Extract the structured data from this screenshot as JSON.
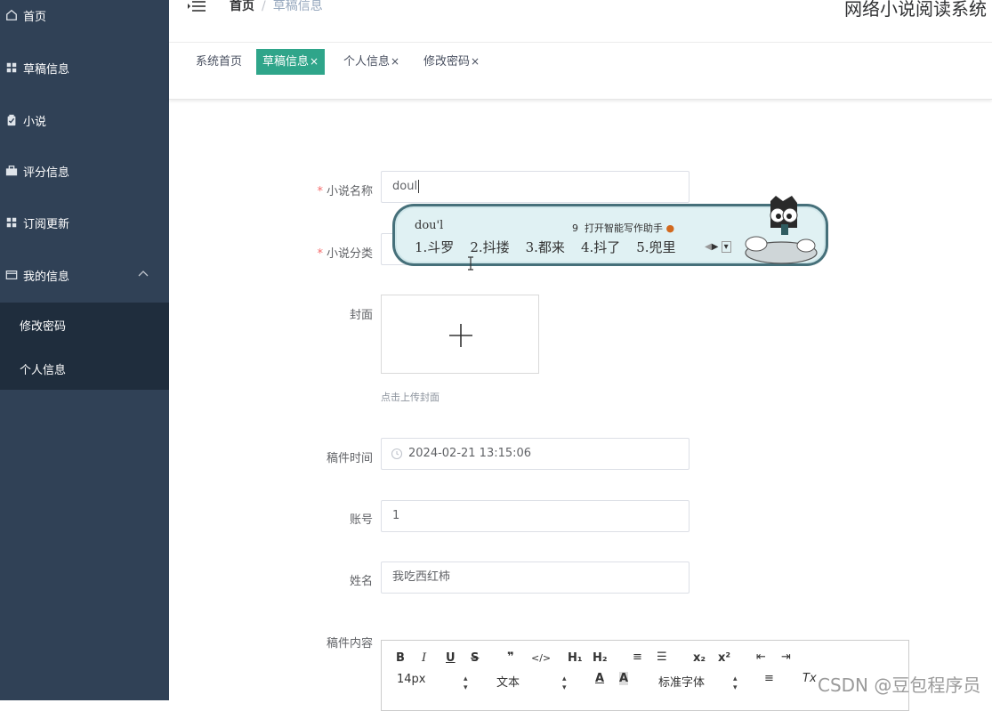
{
  "sidebar": {
    "items": [
      {
        "label": "首页",
        "icon": "home-icon"
      },
      {
        "label": "草稿信息",
        "icon": "grid-icon"
      },
      {
        "label": "小说",
        "icon": "clipboard-check-icon"
      },
      {
        "label": "评分信息",
        "icon": "briefcase-icon"
      },
      {
        "label": "订阅更新",
        "icon": "grid-icon"
      },
      {
        "label": "我的信息",
        "icon": "wallet-icon",
        "expanded": true
      }
    ],
    "submenu": [
      {
        "label": "修改密码"
      },
      {
        "label": "个人信息"
      }
    ]
  },
  "header": {
    "breadcrumb_home": "首页",
    "breadcrumb_sep": "/",
    "breadcrumb_current": "草稿信息",
    "system_title": "网络小说阅读系统"
  },
  "tabs": [
    {
      "label": "系统首页",
      "closable": false,
      "active": false
    },
    {
      "label": "草稿信息",
      "closable": true,
      "active": true
    },
    {
      "label": "个人信息",
      "closable": true,
      "active": false
    },
    {
      "label": "修改密码",
      "closable": true,
      "active": false
    }
  ],
  "tab_close": "×",
  "form": {
    "required_mark": "*",
    "novel_name_label": "小说名称",
    "novel_name_value": "doul",
    "category_label": "小说分类",
    "cover_label": "封面",
    "cover_tip": "点击上传封面",
    "time_label": "稿件时间",
    "time_value": "2024-02-21 13:15:06",
    "account_label": "账号",
    "account_value": "1",
    "name_label": "姓名",
    "name_value": "我吃西红柿",
    "content_label": "稿件内容"
  },
  "editor": {
    "font_size": "14px",
    "paragraph": "文本",
    "font_family": "标准字体",
    "buttons": {
      "bold": "B",
      "italic": "I",
      "underline": "U",
      "strike": "S",
      "quote": "❞",
      "code": "</>",
      "h1": "H₁",
      "h2": "H₂",
      "ordered": "≡",
      "bullet": "☰",
      "sub": "x₂",
      "sup": "x²",
      "outdent": "⇤",
      "indent": "⇥",
      "color": "A",
      "background": "A",
      "align": "≡",
      "clean": "Tx"
    }
  },
  "ime": {
    "pinyin": "dou'l",
    "assist_number": "9",
    "assist_label": "打开智能写作助手",
    "candidates": [
      "1.斗罗",
      "2.抖搂",
      "3.都来",
      "4.抖了",
      "5.兜里"
    ]
  },
  "watermark": "CSDN @豆包程序员",
  "colors": {
    "sidebar_bg": "#304156",
    "submenu_bg": "#1f2d3d",
    "tab_active": "#2fa58a",
    "required": "#f56c6c"
  }
}
